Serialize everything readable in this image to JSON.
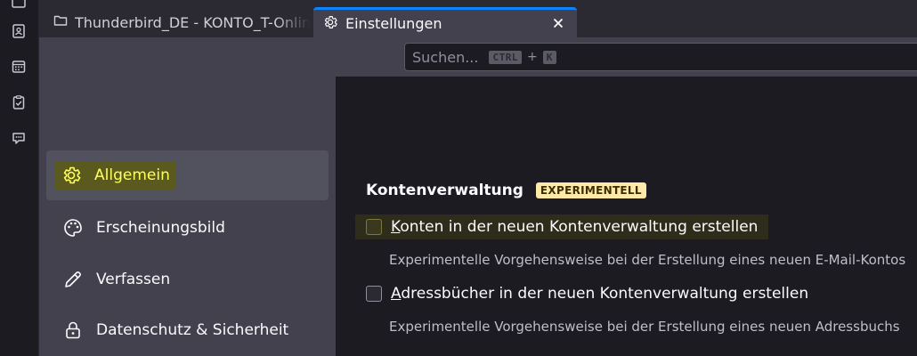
{
  "tabs": [
    {
      "label": "Thunderbird_DE - KONTO_T-Online",
      "icon": "folder-icon"
    },
    {
      "label": "Einstellungen",
      "icon": "gear-icon",
      "close": "✕"
    }
  ],
  "search": {
    "placeholder": "Suchen...",
    "key1": "CTRL",
    "plus": "+",
    "key2": "K"
  },
  "sidebar": {
    "items": [
      {
        "label": "Allgemein",
        "icon": "gear-icon",
        "selected": true
      },
      {
        "label": "Erscheinungsbild",
        "icon": "palette-icon"
      },
      {
        "label": "Verfassen",
        "icon": "pencil-icon"
      },
      {
        "label": "Datenschutz & Sicherheit",
        "icon": "lock-icon"
      }
    ]
  },
  "main": {
    "section_title": "Kontenverwaltung",
    "badge": "EXPERIMENTELL",
    "options": [
      {
        "label_first": "K",
        "label_rest": "onten in der neuen Kontenverwaltung erstellen",
        "description": "Experimentelle Vorgehensweise bei der Erstellung eines neuen E-Mail-Kontos",
        "checked": false
      },
      {
        "label_first": "A",
        "label_rest": "dressbücher in der neuen Kontenverwaltung erstellen",
        "description": "Experimentelle Vorgehensweise bei der Erstellung eines neuen Adressbuchs",
        "checked": false
      }
    ]
  },
  "colors": {
    "accent": "#0a84ff",
    "highlight_text": "#ffff5a",
    "badge_bg": "#ffe9a8"
  }
}
